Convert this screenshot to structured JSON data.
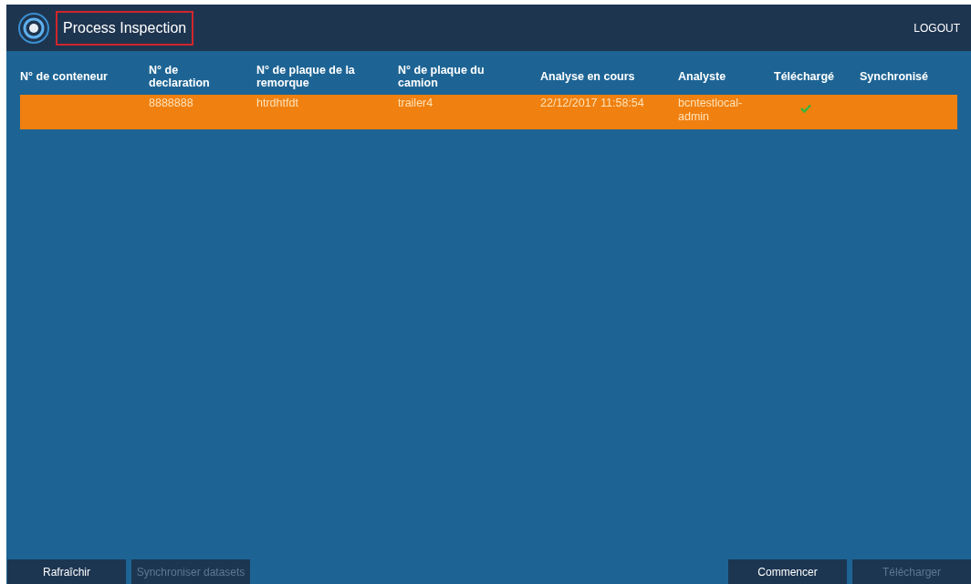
{
  "header": {
    "title": "Process Inspection",
    "logout": "LOGOUT"
  },
  "table": {
    "columns": [
      "N° de conteneur",
      "N° de declaration",
      "N° de plaque de la remorque",
      "N° de plaque du camion",
      "Analyse en cours",
      "Analyste",
      "Téléchargé",
      "Synchronisé"
    ],
    "rows": [
      {
        "selected": true,
        "cells": [
          "",
          "8888888",
          "htrdhtfdt",
          "trailer4",
          "22/12/2017 11:58:54",
          "bcntestlocal-admin"
        ],
        "downloaded": true,
        "synchronized": false
      }
    ]
  },
  "buttons_left": [
    {
      "label": "Rafraîchir",
      "disabled": false
    },
    {
      "label": "Synchroniser datasets",
      "disabled": true
    }
  ],
  "buttons_right": [
    {
      "label": "Commencer",
      "disabled": false
    },
    {
      "label": "Télécharger",
      "disabled": true
    }
  ]
}
